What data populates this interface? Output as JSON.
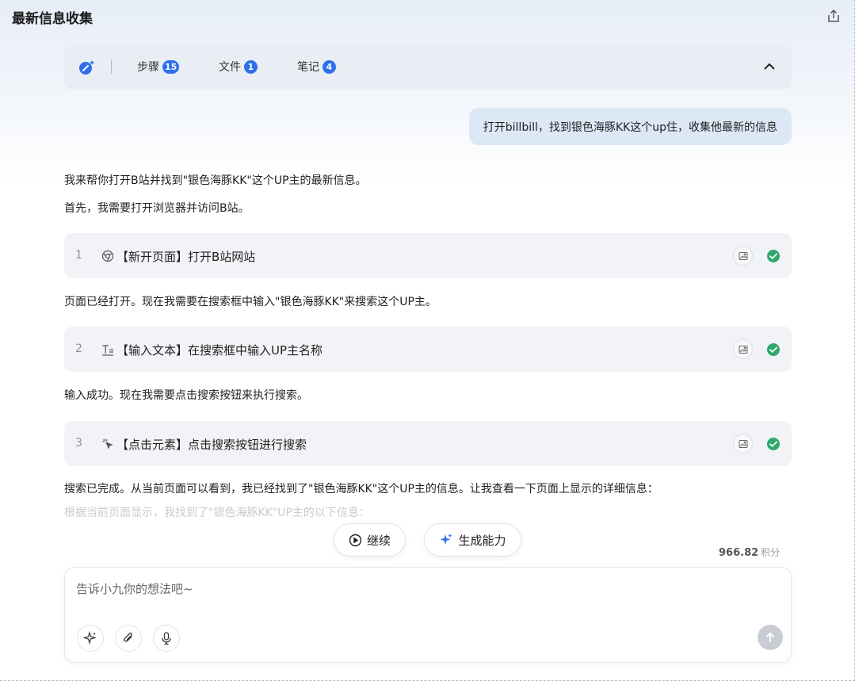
{
  "header": {
    "title": "最新信息收集",
    "share_icon": "share-icon"
  },
  "topbar": {
    "magic_icon": "magic-wand-icon",
    "tabs": [
      {
        "label": "步骤",
        "count": "15"
      },
      {
        "label": "文件",
        "count": "1"
      },
      {
        "label": "笔记",
        "count": "4"
      }
    ],
    "collapse_icon": "chevron-up-icon"
  },
  "conversation": {
    "user_message": "打开billbill，找到银色海豚KK这个up住，收集他最新的信息",
    "intro_1": "我来帮你打开B站并找到\"银色海豚KK\"这个UP主的最新信息。",
    "intro_2": "首先，我需要打开浏览器并访问B站。",
    "steps": [
      {
        "num": "1",
        "icon": "chrome-icon",
        "text": "【新开页面】打开B站网站"
      },
      {
        "num": "2",
        "icon": "text-input-icon",
        "text": "【输入文本】在搜索框中输入UP主名称"
      },
      {
        "num": "3",
        "icon": "click-icon",
        "text": "【点击元素】点击搜索按钮进行搜索"
      }
    ],
    "after_step_1": "页面已经打开。现在我需要在搜索框中输入\"银色海豚KK\"来搜索这个UP主。",
    "after_step_2": "输入成功。现在我需要点击搜索按钮来执行搜索。",
    "after_step_3": "搜索已完成。从当前页面可以看到，我已经找到了\"银色海豚KK\"这个UP主的信息。让我查看一下页面上显示的详细信息：",
    "faded_line": "根据当前页面显示，我找到了\"银色海豚KK\"UP主的以下信息："
  },
  "actions": {
    "continue_label": "继续",
    "generate_label": "生成能力"
  },
  "credits": {
    "value": "966.82",
    "unit": "积分"
  },
  "composer": {
    "placeholder": "告诉小九你的想法吧~",
    "value": ""
  },
  "colors": {
    "accent": "#2f6fec",
    "success": "#2ea86b",
    "bubble": "#dde8f7"
  }
}
